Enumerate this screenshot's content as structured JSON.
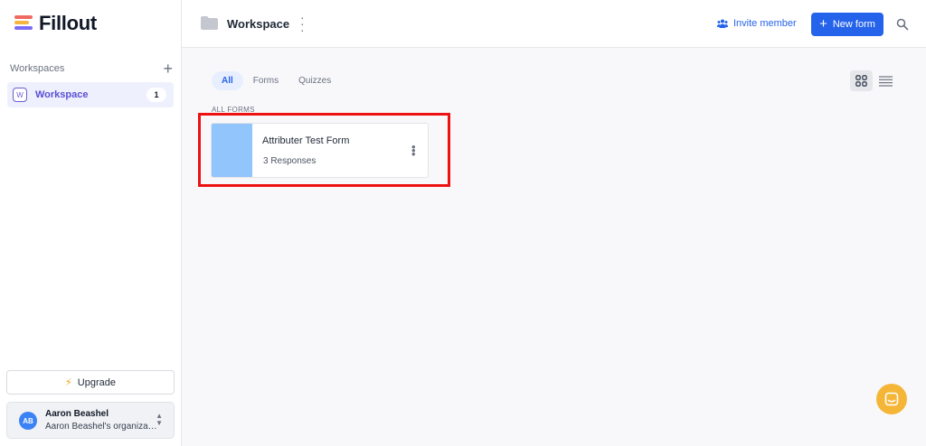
{
  "app": {
    "name": "Fillout"
  },
  "sidebar": {
    "section_label": "Workspaces",
    "add_icon": "plus-icon",
    "items": [
      {
        "badge": "W",
        "label": "Workspace",
        "count": "1",
        "active": true
      }
    ],
    "upgrade_label": "Upgrade",
    "user": {
      "initials": "AB",
      "name": "Aaron Beashel",
      "org": "Aaron Beashel's organization"
    }
  },
  "header": {
    "title": "Workspace",
    "invite_label": "Invite member",
    "new_form_label": "New form"
  },
  "main": {
    "tabs": [
      {
        "label": "All",
        "active": true
      },
      {
        "label": "Forms",
        "active": false
      },
      {
        "label": "Quizzes",
        "active": false
      }
    ],
    "section_label": "ALL FORMS",
    "forms": [
      {
        "title": "Attributer Test Form",
        "responses": "3 Responses",
        "thumb_color": "#93c5fd"
      }
    ]
  },
  "colors": {
    "accent": "#2563eb",
    "highlight": "#ee1111",
    "chat": "#f5b638"
  }
}
